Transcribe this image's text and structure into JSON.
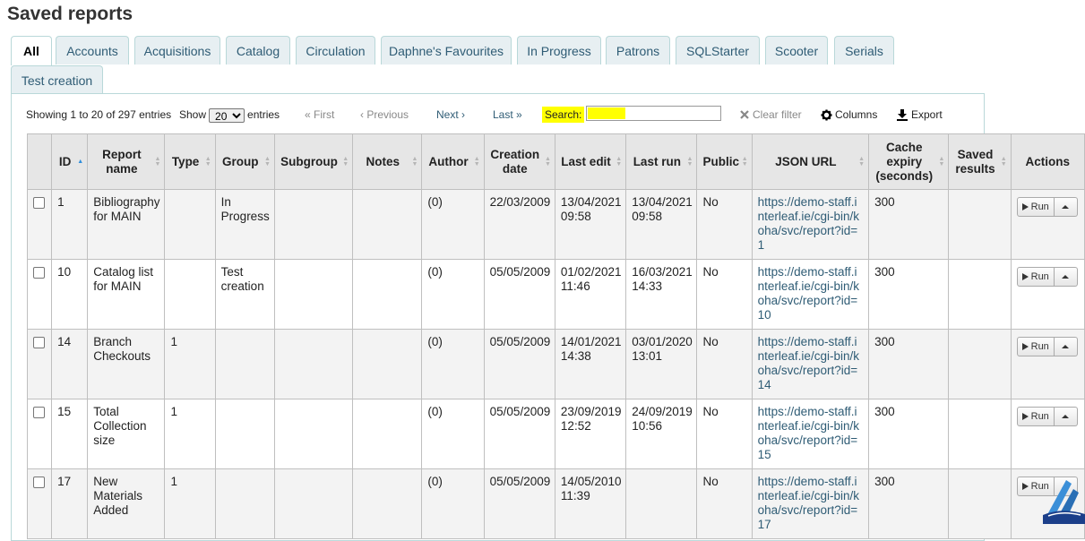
{
  "page_title": "Saved reports",
  "tabs": [
    "All",
    "Accounts",
    "Acquisitions",
    "Catalog",
    "Circulation",
    "Daphne's Favourites",
    "In Progress",
    "Patrons",
    "SQLStarter",
    "Scooter",
    "Serials",
    "Test creation"
  ],
  "toolbar": {
    "info": "Showing 1 to 20 of 297 entries",
    "show_label": "Show",
    "show_value": "20",
    "entries_label": "entries",
    "first": "« First",
    "previous": "‹ Previous",
    "next": "Next ›",
    "last": "Last »",
    "search_label": "Search:",
    "search_value": "",
    "clear_filter": "Clear filter",
    "columns": "Columns",
    "export": "Export"
  },
  "columns": [
    "ID",
    "Report name",
    "Type",
    "Group",
    "Subgroup",
    "Notes",
    "Author",
    "Creation date",
    "Last edit",
    "Last run",
    "Public",
    "JSON URL",
    "Cache expiry (seconds)",
    "Saved results",
    "Actions"
  ],
  "rows": [
    {
      "id": "1",
      "name": "Bibliography for MAIN",
      "type": "",
      "group": "In Progress",
      "subgroup": "",
      "notes": "",
      "author": "(0)",
      "created": "22/03/2009",
      "last_edit": "13/04/2021 09:58",
      "last_run": "13/04/2021 09:58",
      "public": "No",
      "json_url": "https://demo-staff.interleaf.ie/cgi-bin/koha/svc/report?id=1",
      "cache": "300",
      "saved": ""
    },
    {
      "id": "10",
      "name": "Catalog list for MAIN",
      "type": "",
      "group": "Test creation",
      "subgroup": "",
      "notes": "",
      "author": "(0)",
      "created": "05/05/2009",
      "last_edit": "01/02/2021 11:46",
      "last_run": "16/03/2021 14:33",
      "public": "No",
      "json_url": "https://demo-staff.interleaf.ie/cgi-bin/koha/svc/report?id=10",
      "cache": "300",
      "saved": ""
    },
    {
      "id": "14",
      "name": "Branch Checkouts",
      "type": "1",
      "group": "",
      "subgroup": "",
      "notes": "",
      "author": "(0)",
      "created": "05/05/2009",
      "last_edit": "14/01/2021 14:38",
      "last_run": "03/01/2020 13:01",
      "public": "No",
      "json_url": "https://demo-staff.interleaf.ie/cgi-bin/koha/svc/report?id=14",
      "cache": "300",
      "saved": ""
    },
    {
      "id": "15",
      "name": "Total Collection size",
      "type": "1",
      "group": "",
      "subgroup": "",
      "notes": "",
      "author": "(0)",
      "created": "05/05/2009",
      "last_edit": "23/09/2019 12:52",
      "last_run": "24/09/2019 10:56",
      "public": "No",
      "json_url": "https://demo-staff.interleaf.ie/cgi-bin/koha/svc/report?id=15",
      "cache": "300",
      "saved": ""
    },
    {
      "id": "17",
      "name": "New Materials Added",
      "type": "1",
      "group": "",
      "subgroup": "",
      "notes": "",
      "author": "(0)",
      "created": "05/05/2009",
      "last_edit": "14/05/2010 11:39",
      "last_run": "",
      "public": "No",
      "json_url": "https://demo-staff.interleaf.ie/cgi-bin/koha/svc/report?id=17",
      "cache": "300",
      "saved": ""
    }
  ],
  "run_label": "Run",
  "colors": {
    "tab_bg": "#e7eff2",
    "tab_border": "#b9d8d9",
    "link": "#2f5c75",
    "header_bg": "#e6e6e6",
    "search_highlight": "#ffff00"
  }
}
